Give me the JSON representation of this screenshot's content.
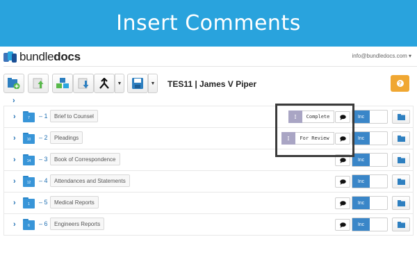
{
  "banner": {
    "title": "Insert Comments"
  },
  "app": {
    "logo": {
      "part1": "bundle",
      "part2": "docs"
    },
    "account": {
      "email": "info@bundledocs.com"
    },
    "document": {
      "title": "TES11 | James V Piper"
    },
    "help_label": "?",
    "toggle_label": "Inc",
    "rows": [
      {
        "number": "1",
        "folder_num": "7",
        "title": "Brief to Counsel",
        "status": "Complete",
        "status_tag": "I"
      },
      {
        "number": "2",
        "folder_num": "10",
        "title": "Pleadings",
        "status": "For Review",
        "status_tag": "I"
      },
      {
        "number": "3",
        "folder_num": "14",
        "title": "Book of Correspondence"
      },
      {
        "number": "4",
        "folder_num": "12",
        "title": "Attendances and Statements"
      },
      {
        "number": "5",
        "folder_num": "1",
        "title": "Medical Reports"
      },
      {
        "number": "6",
        "folder_num": "6",
        "title": "Engineers Reports"
      }
    ]
  },
  "colors": {
    "banner": "#29a3dd",
    "primary": "#3a86c8",
    "help": "#f0a732",
    "status_tag": "#a9a5c4"
  },
  "icons": {
    "toolbar": [
      "add-document-icon",
      "upload-icon",
      "cubes-icon",
      "download-icon",
      "merge-icon",
      "save-icon"
    ],
    "row": [
      "chevron-right-icon",
      "folder-icon",
      "comment-icon",
      "open-folder-icon"
    ]
  }
}
